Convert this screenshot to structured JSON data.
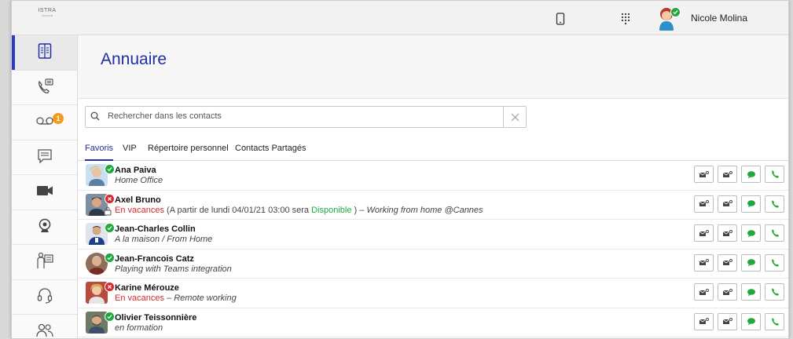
{
  "app": {
    "logo_line1": "ISTRA",
    "logo_line2": "TELECOM"
  },
  "user": {
    "name": "Nicole Molina",
    "status": "available"
  },
  "sidebar": {
    "items": [
      {
        "name": "annuaire",
        "icon": "address-book-icon",
        "active": true
      },
      {
        "name": "calls",
        "icon": "phone-history-icon"
      },
      {
        "name": "voicemail",
        "icon": "voicemail-icon",
        "badge": "1"
      },
      {
        "name": "messages",
        "icon": "chat-icon"
      },
      {
        "name": "video",
        "icon": "video-camera-icon"
      },
      {
        "name": "webcam",
        "icon": "webcam-icon"
      },
      {
        "name": "presence",
        "icon": "person-board-icon"
      },
      {
        "name": "support",
        "icon": "headset-icon"
      },
      {
        "name": "groups",
        "icon": "people-icon"
      }
    ]
  },
  "page": {
    "title": "Annuaire"
  },
  "search": {
    "placeholder": "Rechercher dans les contacts",
    "value": ""
  },
  "tabs": [
    {
      "label": "Favoris",
      "active": true
    },
    {
      "label": "VIP"
    },
    {
      "label": "Répertoire personnel"
    },
    {
      "label": "Contacts Partagés"
    }
  ],
  "contacts": [
    {
      "name": "Ana Paiva",
      "status": "available",
      "line": {
        "text": "Home Office"
      }
    },
    {
      "name": "Axel Bruno",
      "status": "busy",
      "locked": true,
      "line": {
        "red": "En vacances",
        "gray1": " (A partir de lundi 04/01/21 03:00 sera ",
        "green": "Disponible",
        "gray2": " ) – ",
        "text": "Working from home @Cannes"
      }
    },
    {
      "name": "Jean-Charles Collin",
      "status": "available",
      "line": {
        "text": "A la maison / From Home"
      }
    },
    {
      "name": "Jean-Francois Catz",
      "status": "available",
      "line": {
        "text": "Playing with Teams integration"
      }
    },
    {
      "name": "Karine Mérouze",
      "status": "busy",
      "line": {
        "red": "En vacances",
        "gray1": " – ",
        "text": "Remote working"
      }
    },
    {
      "name": "Olivier Teissonnière",
      "status": "available",
      "line": {
        "text": "en formation"
      }
    }
  ],
  "colors": {
    "accent": "#1f2fa8",
    "available": "#1eaa3a",
    "busy": "#d9272e",
    "badge": "#f39a1e"
  }
}
